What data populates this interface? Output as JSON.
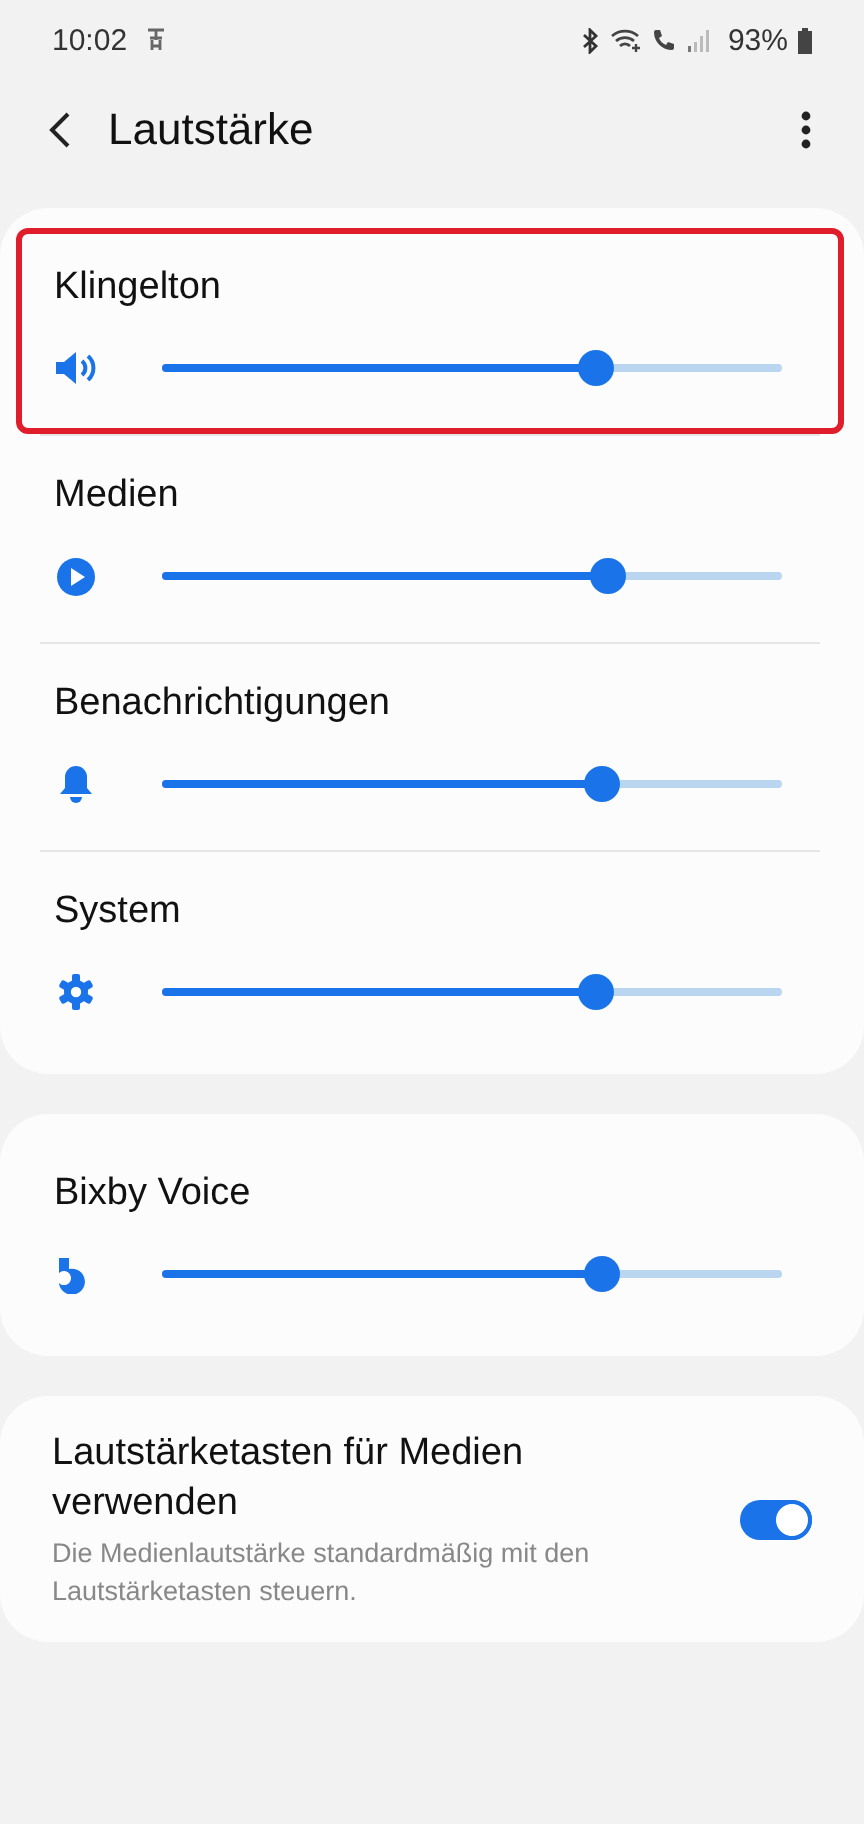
{
  "status_bar": {
    "time": "10:02",
    "battery": "93%"
  },
  "header": {
    "title": "Lautstärke"
  },
  "volume_groups": [
    {
      "sliders": [
        {
          "name": "Klingelton",
          "kind": "speaker",
          "level": 0.7,
          "highlighted": true
        },
        {
          "name": "Medien",
          "kind": "play",
          "level": 0.72,
          "highlighted": false
        },
        {
          "name": "Benachrichtigungen",
          "kind": "bell",
          "level": 0.71,
          "highlighted": false
        },
        {
          "name": "System",
          "kind": "gear",
          "level": 0.7,
          "highlighted": false
        }
      ]
    },
    {
      "sliders": [
        {
          "name": "Bixby Voice",
          "kind": "bixby",
          "level": 0.71,
          "highlighted": false
        }
      ]
    }
  ],
  "media_keys": {
    "title": "Lautstärketasten für Medien verwenden",
    "description": "Die Medienlautstärke standardmäßig mit den Lautstärketasten steuern.",
    "on": true
  }
}
